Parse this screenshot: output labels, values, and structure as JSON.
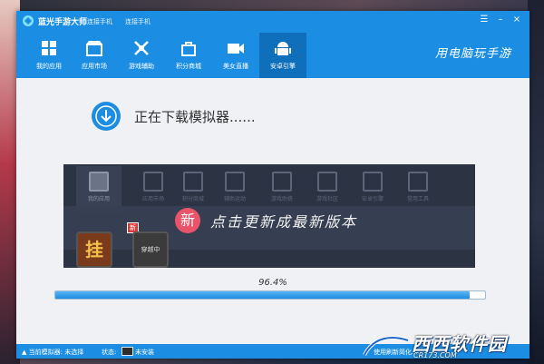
{
  "app": {
    "title": "蓝光手游大师",
    "link_connect_phone": "连接手机",
    "link_connect_phone_2": "连接手机",
    "slogan": "用电脑玩手游"
  },
  "window_controls": {
    "skin": "☰",
    "minimize": "–",
    "close": "×"
  },
  "nav": [
    {
      "label": "我的应用",
      "icon": "grid-icon",
      "active": false
    },
    {
      "label": "应用市场",
      "icon": "store-icon",
      "active": false
    },
    {
      "label": "游戏辅助",
      "icon": "tools-icon",
      "active": false
    },
    {
      "label": "积分商城",
      "icon": "bag-icon",
      "active": false
    },
    {
      "label": "美女直播",
      "icon": "video-icon",
      "active": false
    },
    {
      "label": "安卓引擎",
      "icon": "android-icon",
      "active": true
    }
  ],
  "download": {
    "status_text": "正在下载模拟器......"
  },
  "banner": {
    "ghost_nav": [
      "我的应用",
      "应用市场",
      "积分商城",
      "辅助运动",
      "游戏助搭",
      "游戏社区",
      "安卓引擎",
      "常用工具"
    ],
    "new_badge": "新",
    "update_text": "点击更新成最新版本",
    "tile_badge": "新",
    "tiles": [
      "挂",
      "穿越中"
    ]
  },
  "progress": {
    "percent_label": "96.4%",
    "value": 0.964
  },
  "status_bar": {
    "current_emulator": "▲ 当前模拟器: 未选择",
    "status_label": "状态:",
    "status_value": "未安装",
    "ad": "使用刷新简化..."
  },
  "watermark": {
    "name": "西西软件园",
    "url": "CR173.COM"
  },
  "colors": {
    "accent": "#1b8ee3",
    "active_tab": "#0f6fba",
    "new_badge": "#e9546b"
  }
}
